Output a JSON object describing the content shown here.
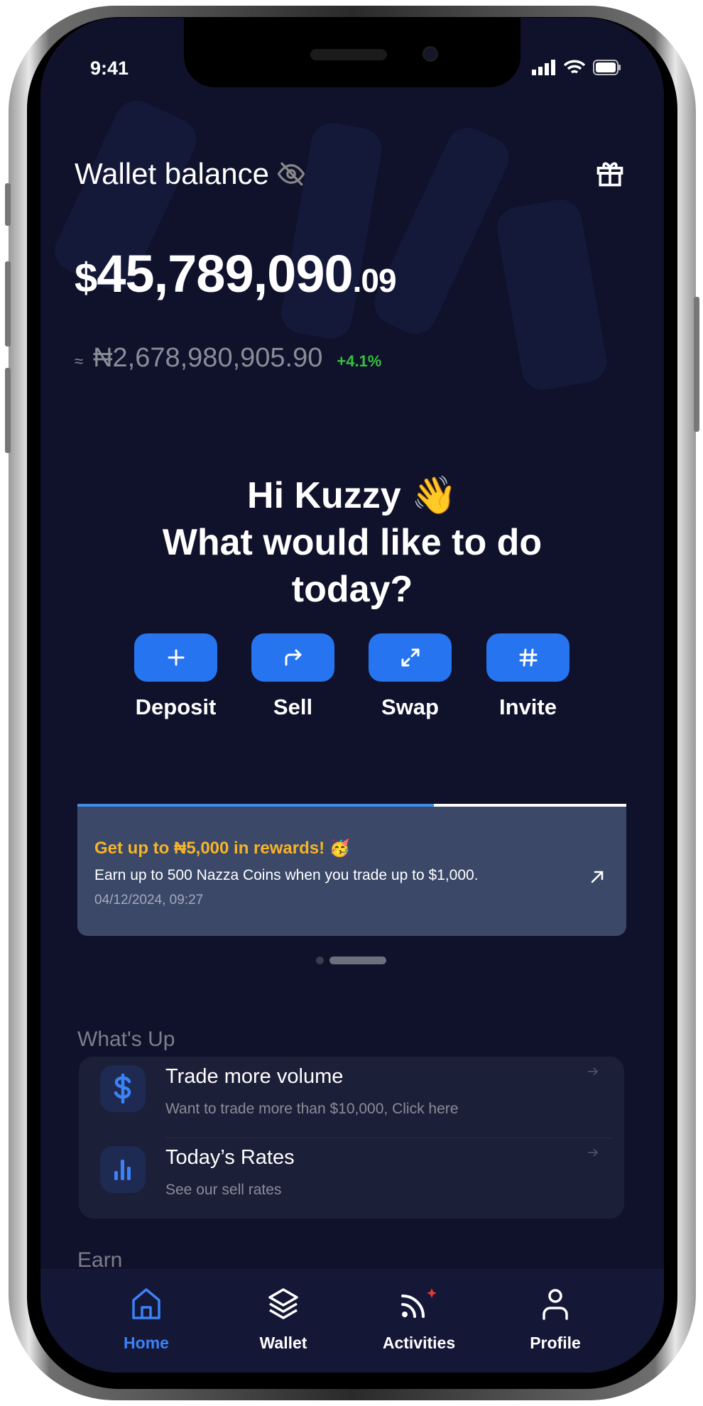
{
  "status_bar": {
    "time": "9:41"
  },
  "wallet": {
    "title": "Wallet balance",
    "balance_currency": "$",
    "balance_whole": "45,789,090",
    "balance_cents": ".09",
    "approx_symbol": "≈",
    "naira_equivalent": "₦2,678,980,905.90",
    "change": "+4.1%"
  },
  "greeting": {
    "line1": "Hi Kuzzy 👋",
    "line2": "What would like to do",
    "line3": "today?"
  },
  "actions": [
    {
      "label": "Deposit",
      "icon": "plus-icon"
    },
    {
      "label": "Sell",
      "icon": "share-arrow-icon"
    },
    {
      "label": "Swap",
      "icon": "expand-icon"
    },
    {
      "label": "Invite",
      "icon": "hash-icon"
    }
  ],
  "banner": {
    "title": "Get up to ₦5,000 in rewards! 🥳",
    "description": "Earn up to 500 Nazza Coins when you trade up to $1,000.",
    "timestamp": "04/12/2024, 09:27",
    "progress": 0.65
  },
  "whats_up": {
    "heading": "What's Up",
    "items": [
      {
        "title": "Trade more volume",
        "subtitle": "Want to trade more than $10,000, Click here",
        "icon": "dollar-icon"
      },
      {
        "title": "Today’s Rates",
        "subtitle": "See our sell rates",
        "icon": "bar-chart-icon"
      }
    ]
  },
  "earn": {
    "heading": "Earn"
  },
  "nav": {
    "items": [
      {
        "label": "Home",
        "active": true
      },
      {
        "label": "Wallet"
      },
      {
        "label": "Activities",
        "badge": true
      },
      {
        "label": "Profile"
      }
    ]
  },
  "colors": {
    "background": "#10122b",
    "accent": "#2674f0",
    "reward": "#f5b429",
    "positive": "#35c23c",
    "badge": "#e53935"
  }
}
